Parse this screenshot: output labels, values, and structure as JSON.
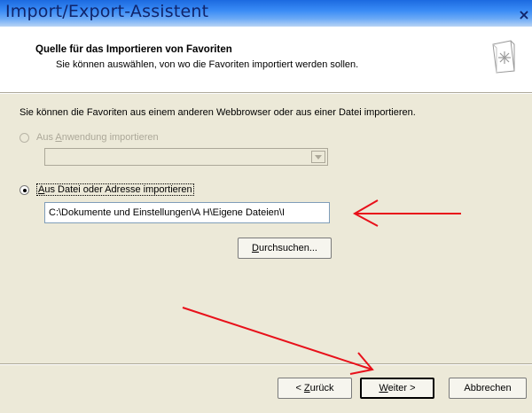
{
  "window": {
    "title": "Import/Export-Assistent",
    "close_glyph": "×"
  },
  "header": {
    "title": "Quelle für das Importieren von Favoriten",
    "subtitle": "Sie können auswählen, von wo die Favoriten importiert werden sollen."
  },
  "body": {
    "intro": "Sie können die Favoriten aus einem anderen Webbrowser oder aus einer Datei importieren.",
    "option_app": {
      "label_pre": "Aus ",
      "label_key": "A",
      "label_post": "nwendung importieren",
      "selected": false,
      "enabled": false
    },
    "app_combo": {
      "value": ""
    },
    "option_file": {
      "label_pre": "",
      "label_key": "A",
      "label_post": "us Datei oder Adresse importieren",
      "selected": true,
      "enabled": true
    },
    "file_path": "C:\\Dokumente und Einstellungen\\A H\\Eigene Dateien\\I",
    "browse_button": {
      "key": "D",
      "rest": "urchsuchen..."
    }
  },
  "footer": {
    "back": {
      "pre": "< ",
      "key": "Z",
      "rest": "urück"
    },
    "next": {
      "key": "W",
      "rest": "eiter >"
    },
    "cancel": "Abbrechen"
  },
  "colors": {
    "annotation_arrow": "#e8101a",
    "titlebar_text": "#10246a"
  },
  "icons": [
    "wizard-icon",
    "close-icon",
    "dropdown-arrow-icon",
    "annotation-arrow"
  ]
}
